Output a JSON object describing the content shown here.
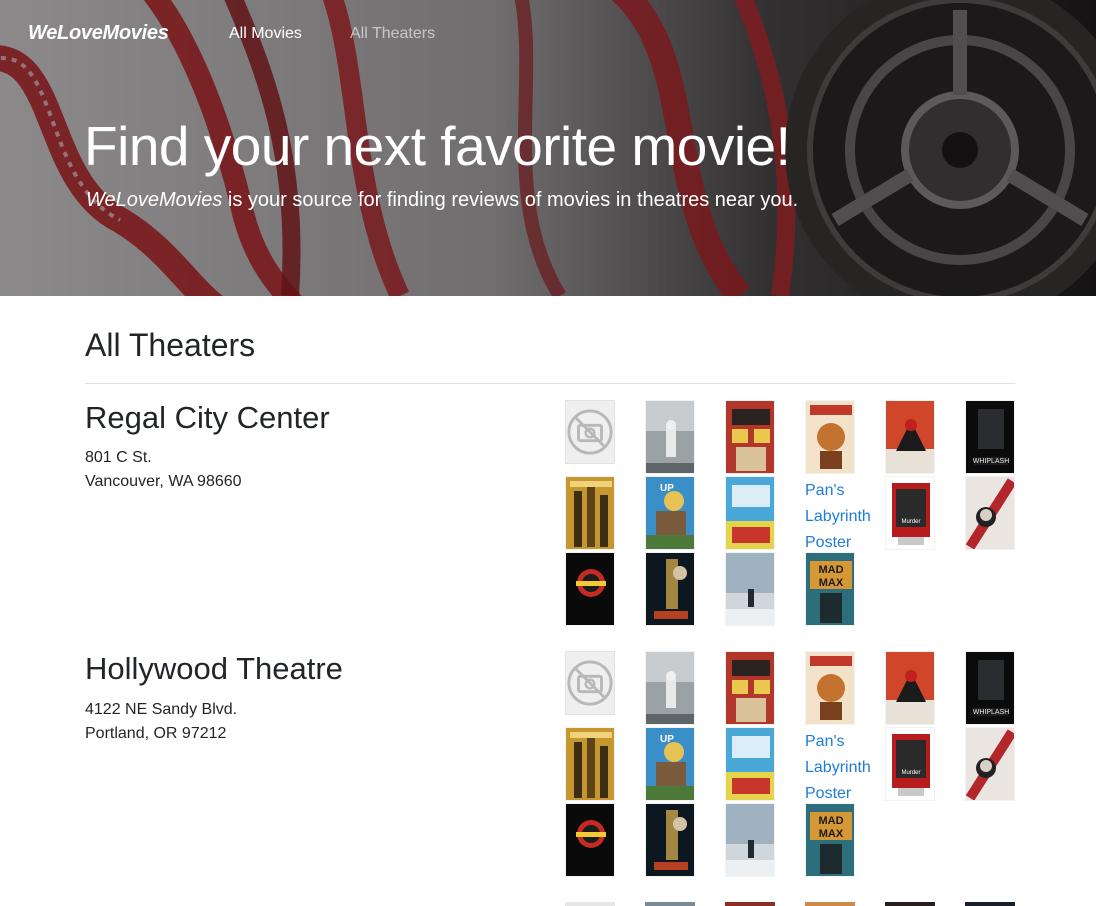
{
  "nav": {
    "brand": "WeLoveMovies",
    "links": [
      {
        "label": "All Movies",
        "active": true
      },
      {
        "label": "All Theaters",
        "active": false
      }
    ]
  },
  "hero": {
    "title": "Find your next favorite movie!",
    "lead_brand": "WeLoveMovies",
    "lead_text": " is your source for finding reviews of movies in theatres near you."
  },
  "page": {
    "heading": "All Theaters"
  },
  "theaters": [
    {
      "name": "Regal City Center",
      "address_line1": "801 C St.",
      "address_line2": "Vancouver, WA 98660",
      "poster_alt_text": "Pan's Labyrinth Poster"
    },
    {
      "name": "Hollywood Theatre",
      "address_line1": "4122 NE Sandy Blvd.",
      "address_line2": "Portland, OR 97212",
      "poster_alt_text": "Pan's Labyrinth Poster"
    }
  ],
  "posters": [
    {
      "icon": "no-image-icon"
    },
    {
      "name": "interstellar"
    },
    {
      "name": "rear-window"
    },
    {
      "name": "raiders-of-the-lost-ark"
    },
    {
      "name": "spider-verse"
    },
    {
      "name": "whiplash"
    },
    {
      "name": "metropolis"
    },
    {
      "name": "up"
    },
    {
      "name": "monty-python-holy-grail"
    },
    {
      "name": "pans-labyrinth"
    },
    {
      "name": "dial-m-for-murder"
    },
    {
      "name": "v-for-vendetta"
    },
    {
      "name": "jurassic-park"
    },
    {
      "name": "blade-runner"
    },
    {
      "name": "come-play"
    },
    {
      "name": "mad-max"
    }
  ],
  "poster_text": {
    "whiplash": "WHIPLASH",
    "mad_max_line1": "MAD",
    "mad_max_line2": "MAX",
    "up": "UP",
    "dial": "Murder"
  },
  "colors": {
    "link": "#1f7bd8",
    "text": "#212529",
    "hero_text": "#ffffff"
  }
}
